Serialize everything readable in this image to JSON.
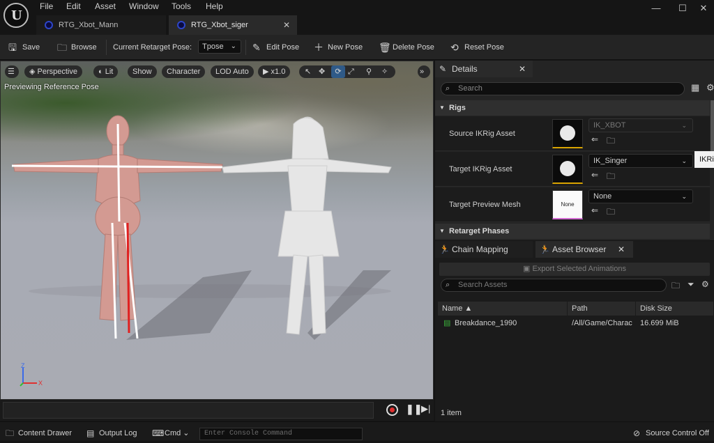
{
  "menu": [
    "File",
    "Edit",
    "Asset",
    "Window",
    "Tools",
    "Help"
  ],
  "window_controls": {
    "minimize": "—",
    "maximize": "☐",
    "close": "✕"
  },
  "tabs": [
    {
      "label": "RTG_Xbot_Mann"
    },
    {
      "label": "RTG_Xbot_siger"
    }
  ],
  "toolbar": {
    "save": "Save",
    "browse": "Browse",
    "pose_label": "Current Retarget Pose:",
    "pose_value": "Tpose",
    "edit_pose": "Edit Pose",
    "new_pose": "New Pose",
    "delete_pose": "Delete Pose",
    "reset_pose": "Reset Pose"
  },
  "viewport": {
    "buttons": {
      "perspective": "Perspective",
      "lit": "Lit",
      "show": "Show",
      "character": "Character",
      "lod": "LOD Auto",
      "speed": "x1.0"
    },
    "label": "Previewing Reference Pose",
    "axes": {
      "z": "Z",
      "x": "X"
    }
  },
  "details": {
    "tab_label": "Details",
    "search_placeholder": "Search",
    "section_rigs": "Rigs",
    "rows": [
      {
        "label": "Source IKRig Asset",
        "value": "IK_XBOT",
        "thumb": ""
      },
      {
        "label": "Target IKRig Asset",
        "value": "IK_Singer",
        "thumb": ""
      },
      {
        "label": "Target Preview Mesh",
        "value": "None",
        "thumb": "None"
      }
    ],
    "section_phases": "Retarget Phases"
  },
  "tooltip": "IKRi",
  "lower_panel": {
    "tabs": [
      {
        "label": "Chain Mapping"
      },
      {
        "label": "Asset Browser"
      }
    ],
    "export_label": "Export Selected Animations",
    "search_placeholder": "Search Assets",
    "columns": [
      "Name",
      "Path",
      "Disk Size"
    ],
    "rows": [
      {
        "name": "Breakdance_1990",
        "path": "/All/Game/Charac",
        "size": "16.699 MiB"
      }
    ],
    "count": "1 item"
  },
  "statusbar": {
    "content_drawer": "Content Drawer",
    "output_log": "Output Log",
    "cmd": "Cmd",
    "console_placeholder": "Enter Console Command",
    "source_control": "Source Control Off"
  },
  "colors": {
    "accent": "#d9a400",
    "tab_blue": "#2d46c9",
    "record_red": "#e03030"
  }
}
